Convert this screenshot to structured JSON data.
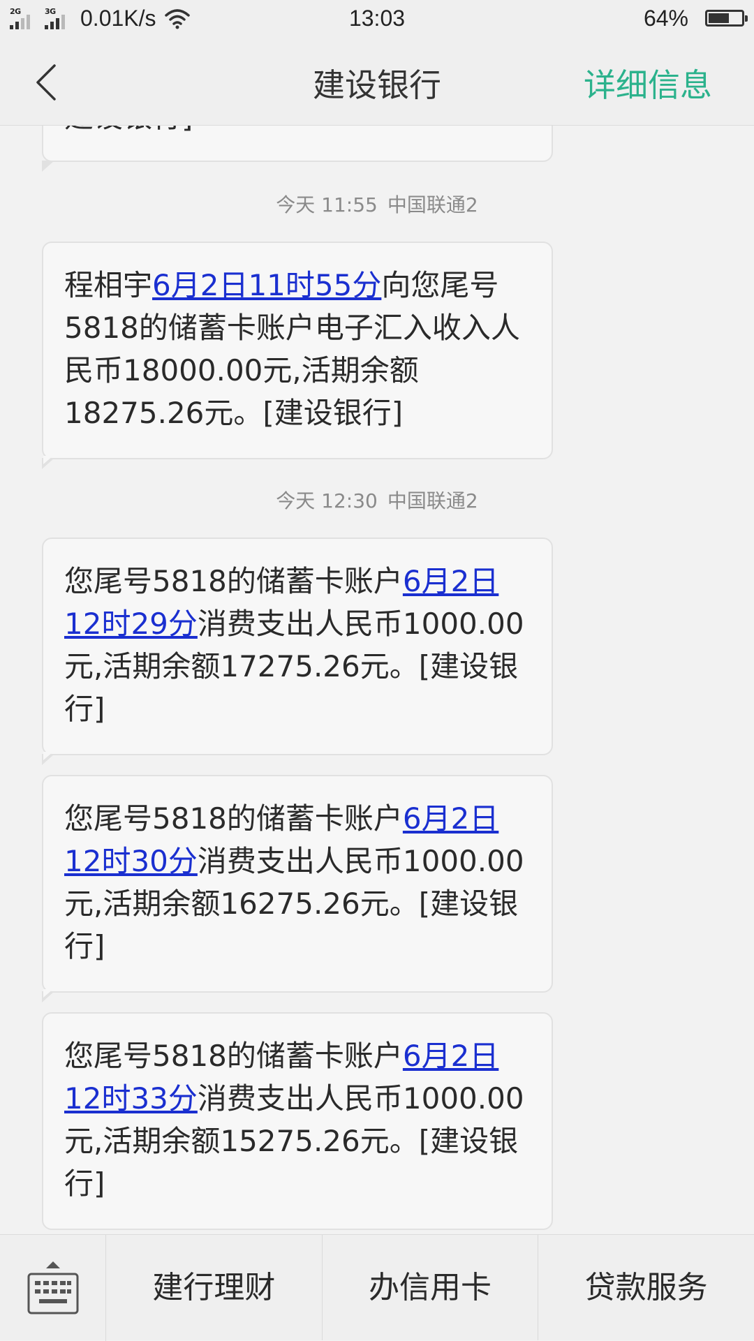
{
  "status_bar": {
    "net1": "2G",
    "net2": "3G",
    "speed": "0.01K/s",
    "time": "13:03",
    "battery_pct": "64%",
    "battery_level": 0.64
  },
  "header": {
    "title": "建设银行",
    "detail_label": "详细信息"
  },
  "partial_message": {
    "text": "建设银行]"
  },
  "messages": [
    {
      "meta_time": "今天  11:55",
      "meta_carrier": "中国联通2",
      "pre": "程相宇",
      "link": "6月2日11时55分",
      "post": "向您尾号5818的储蓄卡账户电子汇入收入人民币18000.00元,活期余额18275.26元。[建设银行]"
    },
    {
      "meta_time": "今天  12:30",
      "meta_carrier": "中国联通2",
      "pre": "您尾号5818的储蓄卡账户",
      "link": "6月2日12时29分",
      "post": "消费支出人民币1000.00元,活期余额17275.26元。[建设银行]"
    },
    {
      "pre": "您尾号5818的储蓄卡账户",
      "link": "6月2日12时30分",
      "post": "消费支出人民币1000.00元,活期余额16275.26元。[建设银行]"
    },
    {
      "pre": "您尾号5818的储蓄卡账户",
      "link": "6月2日12时33分",
      "post": "消费支出人民币1000.00元,活期余额15275.26元。[建设银行]"
    }
  ],
  "bottom_bar": {
    "items": [
      "建行理财",
      "办信用卡",
      "贷款服务"
    ]
  },
  "colors": {
    "accent": "#2bb28c",
    "link": "#1a2fd0"
  },
  "icons": {
    "back": "chevron-left-icon",
    "keyboard": "keyboard-icon",
    "wifi": "wifi-icon",
    "battery": "battery-icon"
  }
}
